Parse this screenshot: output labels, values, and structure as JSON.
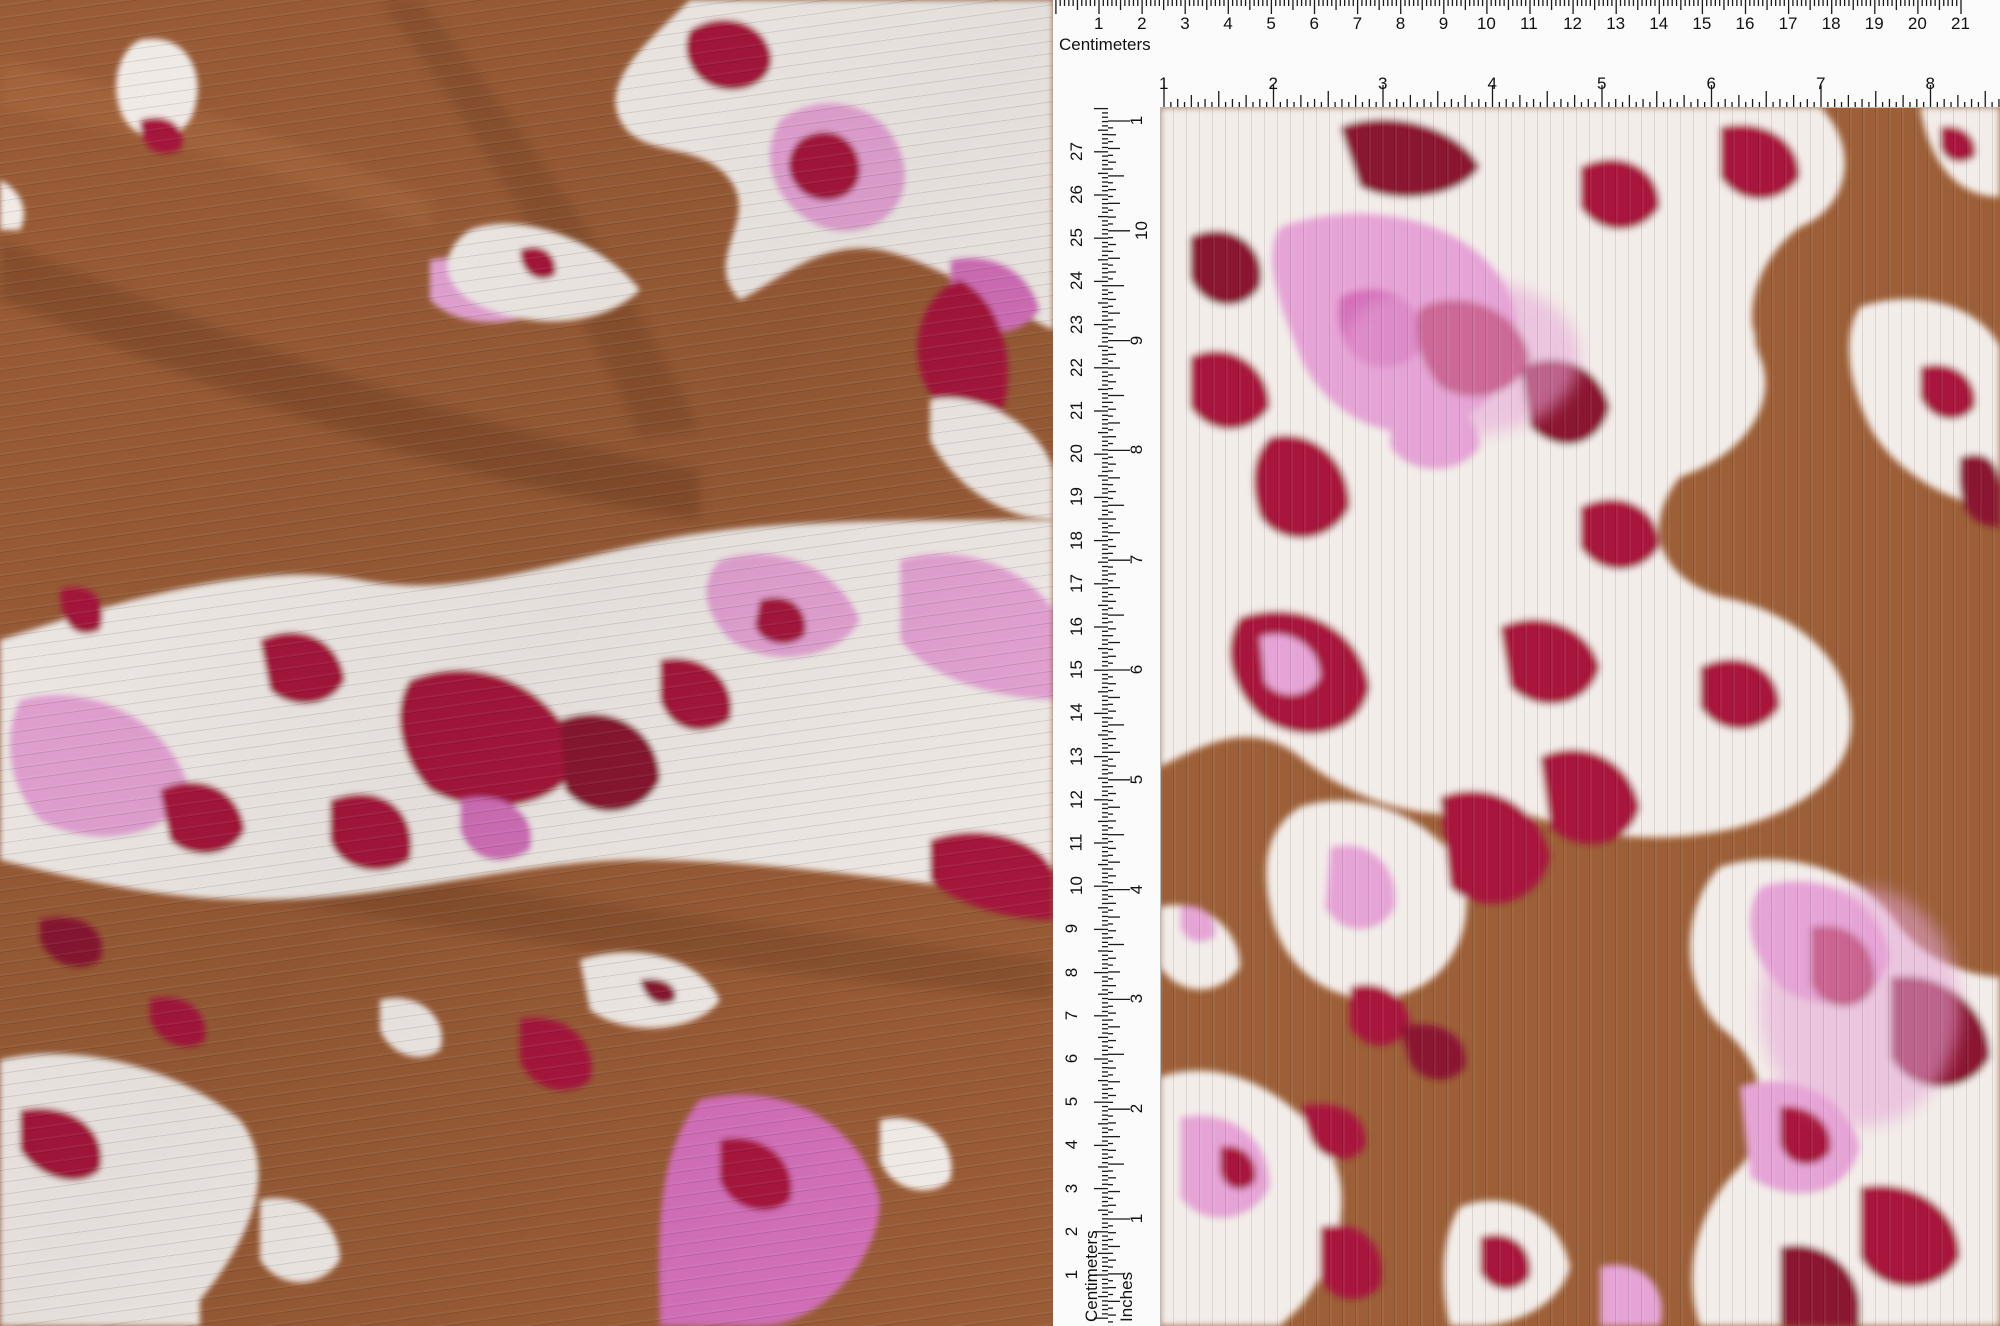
{
  "scene": {
    "colors": {
      "ground": "#9a5c36",
      "cream": "#f3ede9",
      "pink": "#e6a4d6",
      "magenta": "#d46fba",
      "crimson": "#a8163c",
      "wine": "#8b1230",
      "ruler_bg": "#fbfbfb",
      "ruler_ink": "#111111"
    },
    "photos": [
      "draped fabric photo",
      "flat fabric sample with rulers"
    ]
  },
  "ruler": {
    "cm_label": "Centimeters",
    "inch_label": "Inches",
    "cm_horizontal": [
      "1",
      "2",
      "3",
      "4",
      "5",
      "6",
      "7",
      "8",
      "9",
      "10",
      "11",
      "12",
      "13",
      "14",
      "15",
      "16",
      "17",
      "18",
      "19",
      "20",
      "21"
    ],
    "inch_horizontal": [
      "1",
      "2",
      "3",
      "4",
      "5",
      "6",
      "7",
      "8"
    ],
    "cm_vertical": [
      "1",
      "2",
      "3",
      "4",
      "5",
      "6",
      "7",
      "8",
      "9",
      "10",
      "11",
      "12",
      "13",
      "14",
      "15",
      "16",
      "17",
      "18",
      "19",
      "20",
      "21",
      "22",
      "23",
      "24",
      "25",
      "26",
      "27",
      "2"
    ],
    "inch_vertical": [
      "1",
      "2",
      "3",
      "4",
      "5",
      "6",
      "7",
      "8",
      "9",
      "10",
      "1"
    ]
  }
}
